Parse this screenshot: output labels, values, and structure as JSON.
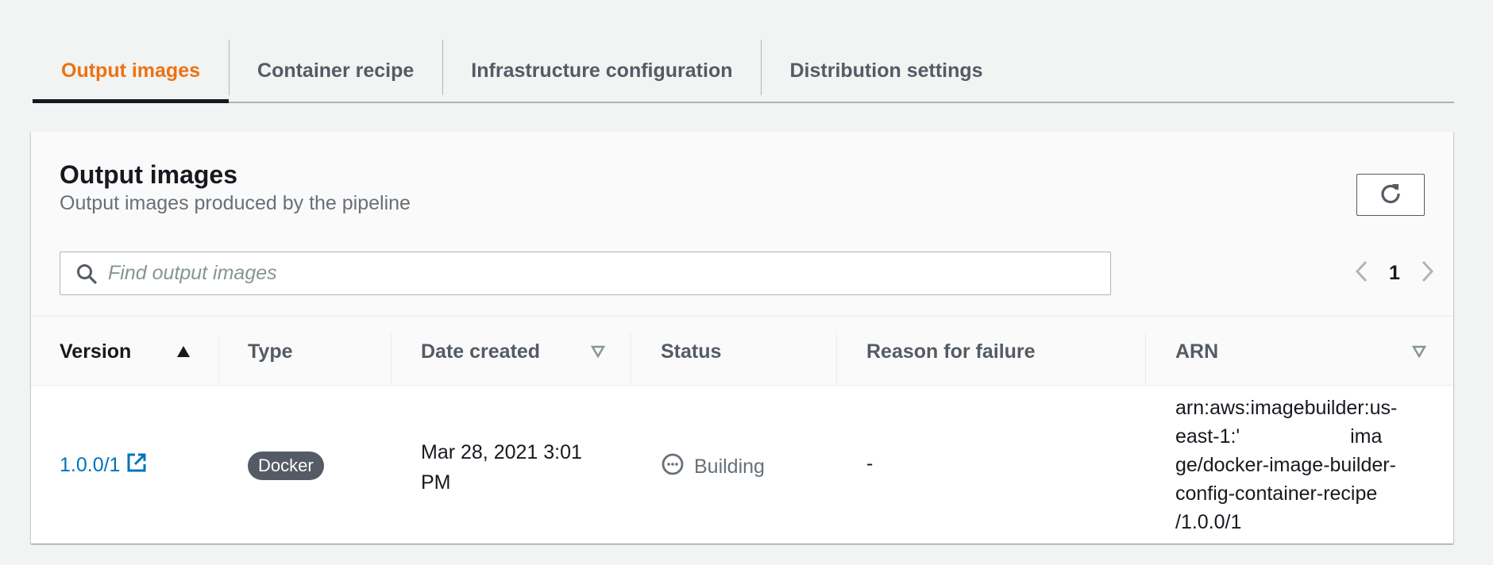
{
  "tabs": [
    {
      "label": "Output images",
      "active": true
    },
    {
      "label": "Container recipe",
      "active": false
    },
    {
      "label": "Infrastructure configuration",
      "active": false
    },
    {
      "label": "Distribution settings",
      "active": false
    }
  ],
  "panel": {
    "title": "Output images",
    "description": "Output images produced by the pipeline",
    "refresh_icon": "refresh-icon"
  },
  "search": {
    "placeholder": "Find output images",
    "value": "",
    "icon": "search-icon"
  },
  "pagination": {
    "current_page": "1",
    "prev_icon": "chevron-left-icon",
    "next_icon": "chevron-right-icon"
  },
  "table": {
    "columns": [
      {
        "label": "Version",
        "sort": "ascending"
      },
      {
        "label": "Type",
        "sort": null
      },
      {
        "label": "Date created",
        "sort": "sortable"
      },
      {
        "label": "Status",
        "sort": null
      },
      {
        "label": "Reason for failure",
        "sort": null
      },
      {
        "label": "ARN",
        "sort": "sortable"
      }
    ],
    "rows": [
      {
        "version": "1.0.0/1",
        "version_icon": "external-link-icon",
        "type": "Docker",
        "date_created_line1": "Mar 28, 2021 3:01",
        "date_created_line2": "PM",
        "status": "Building",
        "status_icon": "in-progress-icon",
        "reason_for_failure": "-",
        "arn_lines": [
          "arn:aws:imagebuilder:us-",
          "east-1:'                    ima",
          "ge/docker-image-builder-",
          "config-container-recipe",
          "/1.0.0/1"
        ]
      }
    ]
  },
  "colors": {
    "accent_active_tab": "#ec7211",
    "link": "#0073bb",
    "badge_bg": "#545b64"
  }
}
